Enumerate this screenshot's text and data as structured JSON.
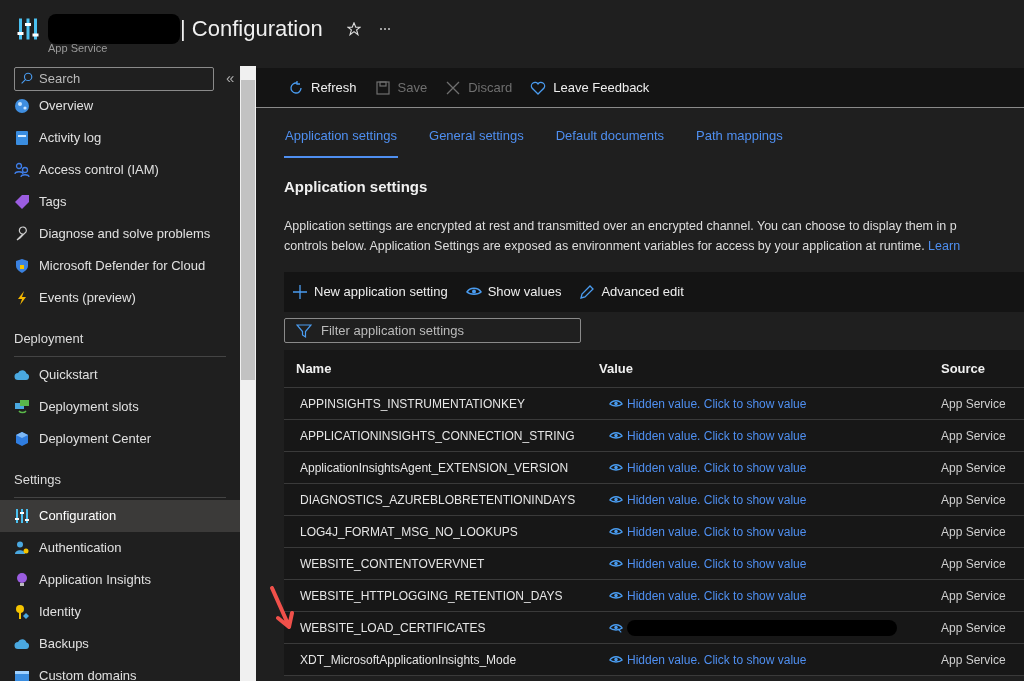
{
  "header": {
    "title": "| Configuration",
    "subtitle": "App Service",
    "title_redacted": true
  },
  "sidebar": {
    "search": {
      "placeholder": "Search"
    },
    "collapse": "«",
    "groups": [
      {
        "items": [
          {
            "label": "Overview",
            "selected": false
          },
          {
            "label": "Activity log",
            "selected": false
          },
          {
            "label": "Access control (IAM)",
            "selected": false
          },
          {
            "label": "Tags",
            "selected": false
          },
          {
            "label": "Diagnose and solve problems",
            "selected": false
          },
          {
            "label": "Microsoft Defender for Cloud",
            "selected": false
          },
          {
            "label": "Events (preview)",
            "selected": false
          }
        ]
      },
      {
        "heading": "Deployment",
        "items": [
          {
            "label": "Quickstart",
            "selected": false
          },
          {
            "label": "Deployment slots",
            "selected": false
          },
          {
            "label": "Deployment Center",
            "selected": false
          }
        ]
      },
      {
        "heading": "Settings",
        "items": [
          {
            "label": "Configuration",
            "selected": true
          },
          {
            "label": "Authentication",
            "selected": false
          },
          {
            "label": "Application Insights",
            "selected": false
          },
          {
            "label": "Identity",
            "selected": false
          },
          {
            "label": "Backups",
            "selected": false
          },
          {
            "label": "Custom domains",
            "selected": false
          }
        ]
      }
    ]
  },
  "toolbar": [
    {
      "label": "Refresh",
      "disabled": false
    },
    {
      "label": "Save",
      "disabled": true
    },
    {
      "label": "Discard",
      "disabled": true
    },
    {
      "label": "Leave Feedback",
      "disabled": false
    }
  ],
  "tabs": [
    {
      "label": "Application settings",
      "selected": true
    },
    {
      "label": "General settings",
      "selected": false
    },
    {
      "label": "Default documents",
      "selected": false
    },
    {
      "label": "Path mappings",
      "selected": false
    }
  ],
  "section": {
    "title": "Application settings",
    "lines": [
      "Application settings are encrypted at rest and transmitted over an encrypted channel. You can choose to display them in p",
      "controls below. Application Settings are exposed as environment variables for access by your application at runtime."
    ],
    "link": "Learn"
  },
  "commands": [
    {
      "label": "New application setting"
    },
    {
      "label": "Show values"
    },
    {
      "label": "Advanced edit"
    }
  ],
  "filter": {
    "placeholder": "Filter application settings"
  },
  "table": {
    "columns": [
      "Name",
      "Value",
      "Source"
    ],
    "rows": [
      {
        "name": "APPINSIGHTS_INSTRUMENTATIONKEY",
        "kind": "hidden",
        "value": "Hidden value. Click to show value",
        "source": "App Service"
      },
      {
        "name": "APPLICATIONINSIGHTS_CONNECTION_STRING",
        "kind": "hidden",
        "value": "Hidden value. Click to show value",
        "source": "App Service"
      },
      {
        "name": "ApplicationInsightsAgent_EXTENSION_VERSION",
        "kind": "hidden",
        "value": "Hidden value. Click to show value",
        "source": "App Service"
      },
      {
        "name": "DIAGNOSTICS_AZUREBLOBRETENTIONINDAYS",
        "kind": "hidden",
        "value": "Hidden value. Click to show value",
        "source": "App Service"
      },
      {
        "name": "LOG4J_FORMAT_MSG_NO_LOOKUPS",
        "kind": "hidden",
        "value": "Hidden value. Click to show value",
        "source": "App Service"
      },
      {
        "name": "WEBSITE_CONTENTOVERVNET",
        "kind": "hidden",
        "value": "Hidden value. Click to show value",
        "source": "App Service"
      },
      {
        "name": "WEBSITE_HTTPLOGGING_RETENTION_DAYS",
        "kind": "hidden",
        "value": "Hidden value. Click to show value",
        "source": "App Service"
      },
      {
        "name": "WEBSITE_LOAD_CERTIFICATES",
        "kind": "redacted",
        "source": "App Service",
        "annotated": true
      },
      {
        "name": "XDT_MicrosoftApplicationInsights_Mode",
        "kind": "hidden",
        "value": "Hidden value. Click to show value",
        "source": "App Service"
      }
    ]
  }
}
